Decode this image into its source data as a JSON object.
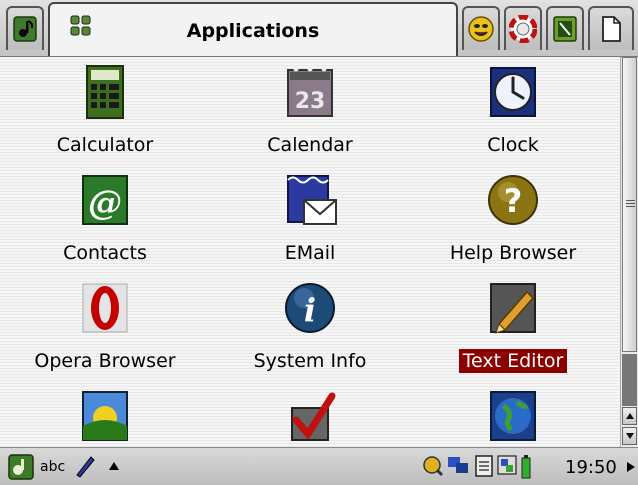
{
  "tabs": [
    {
      "name": "home",
      "icon": "home-tab-icon"
    },
    {
      "name": "applications",
      "label": "Applications",
      "icon": "applications-grid-icon"
    },
    {
      "name": "games",
      "icon": "smiley-face-icon"
    },
    {
      "name": "settings",
      "icon": "lifebuoy-icon"
    },
    {
      "name": "utilities",
      "icon": "utilities-icon"
    },
    {
      "name": "documents",
      "icon": "document-icon"
    }
  ],
  "apps": [
    {
      "label": "Calculator",
      "icon": "calculator-icon"
    },
    {
      "label": "Calendar",
      "icon": "calendar-icon",
      "icon_text": "23"
    },
    {
      "label": "Clock",
      "icon": "clock-icon"
    },
    {
      "label": "Contacts",
      "icon": "contacts-at-icon",
      "icon_text": "@"
    },
    {
      "label": "EMail",
      "icon": "email-envelope-icon"
    },
    {
      "label": "Help Browser",
      "icon": "help-question-icon",
      "icon_text": "?"
    },
    {
      "label": "Opera Browser",
      "icon": "opera-icon"
    },
    {
      "label": "System Info",
      "icon": "info-icon",
      "icon_text": "i"
    },
    {
      "label": "Text Editor",
      "icon": "pencil-icon",
      "selected": true
    },
    {
      "label": "",
      "icon": "landscape-sun-icon"
    },
    {
      "label": "",
      "icon": "checkmark-icon"
    },
    {
      "label": "",
      "icon": "globe-icon"
    }
  ],
  "statusbar": {
    "input_mode": "abc",
    "time": "19:50"
  },
  "colors": {
    "selection": "#8b0000",
    "tab_active": "#f3f3f3"
  }
}
